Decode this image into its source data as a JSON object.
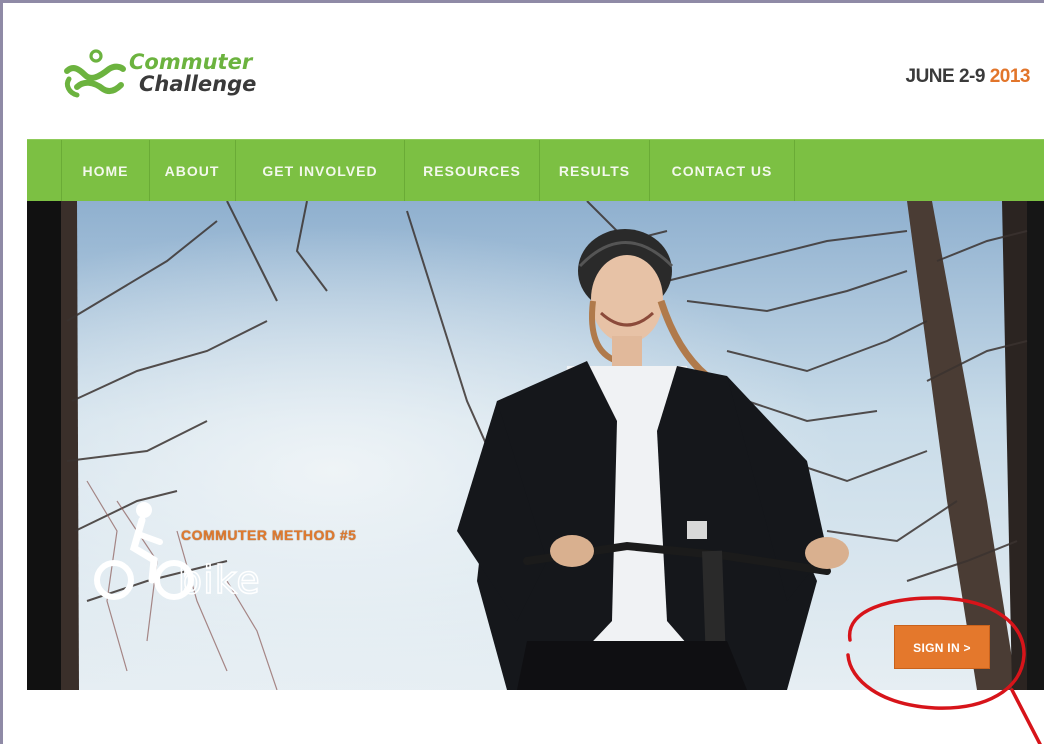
{
  "header": {
    "logo": {
      "line1": "Commuter",
      "line2": "Challenge"
    },
    "event_date": {
      "prefix": "JUNE 2-9 ",
      "year": "2013"
    }
  },
  "nav": {
    "items": [
      {
        "label": "HOME"
      },
      {
        "label": "ABOUT"
      },
      {
        "label": "GET INVOLVED"
      },
      {
        "label": "RESOURCES"
      },
      {
        "label": "RESULTS"
      },
      {
        "label": "CONTACT US"
      }
    ]
  },
  "hero": {
    "method_label": "COMMUTER METHOD #5",
    "method_name": "bike",
    "signin_label": "SIGN IN >"
  },
  "colors": {
    "nav_green": "#7cc043",
    "logo_green": "#6cb33f",
    "accent_orange": "#e4782c",
    "annotation_red": "#d7141a"
  }
}
